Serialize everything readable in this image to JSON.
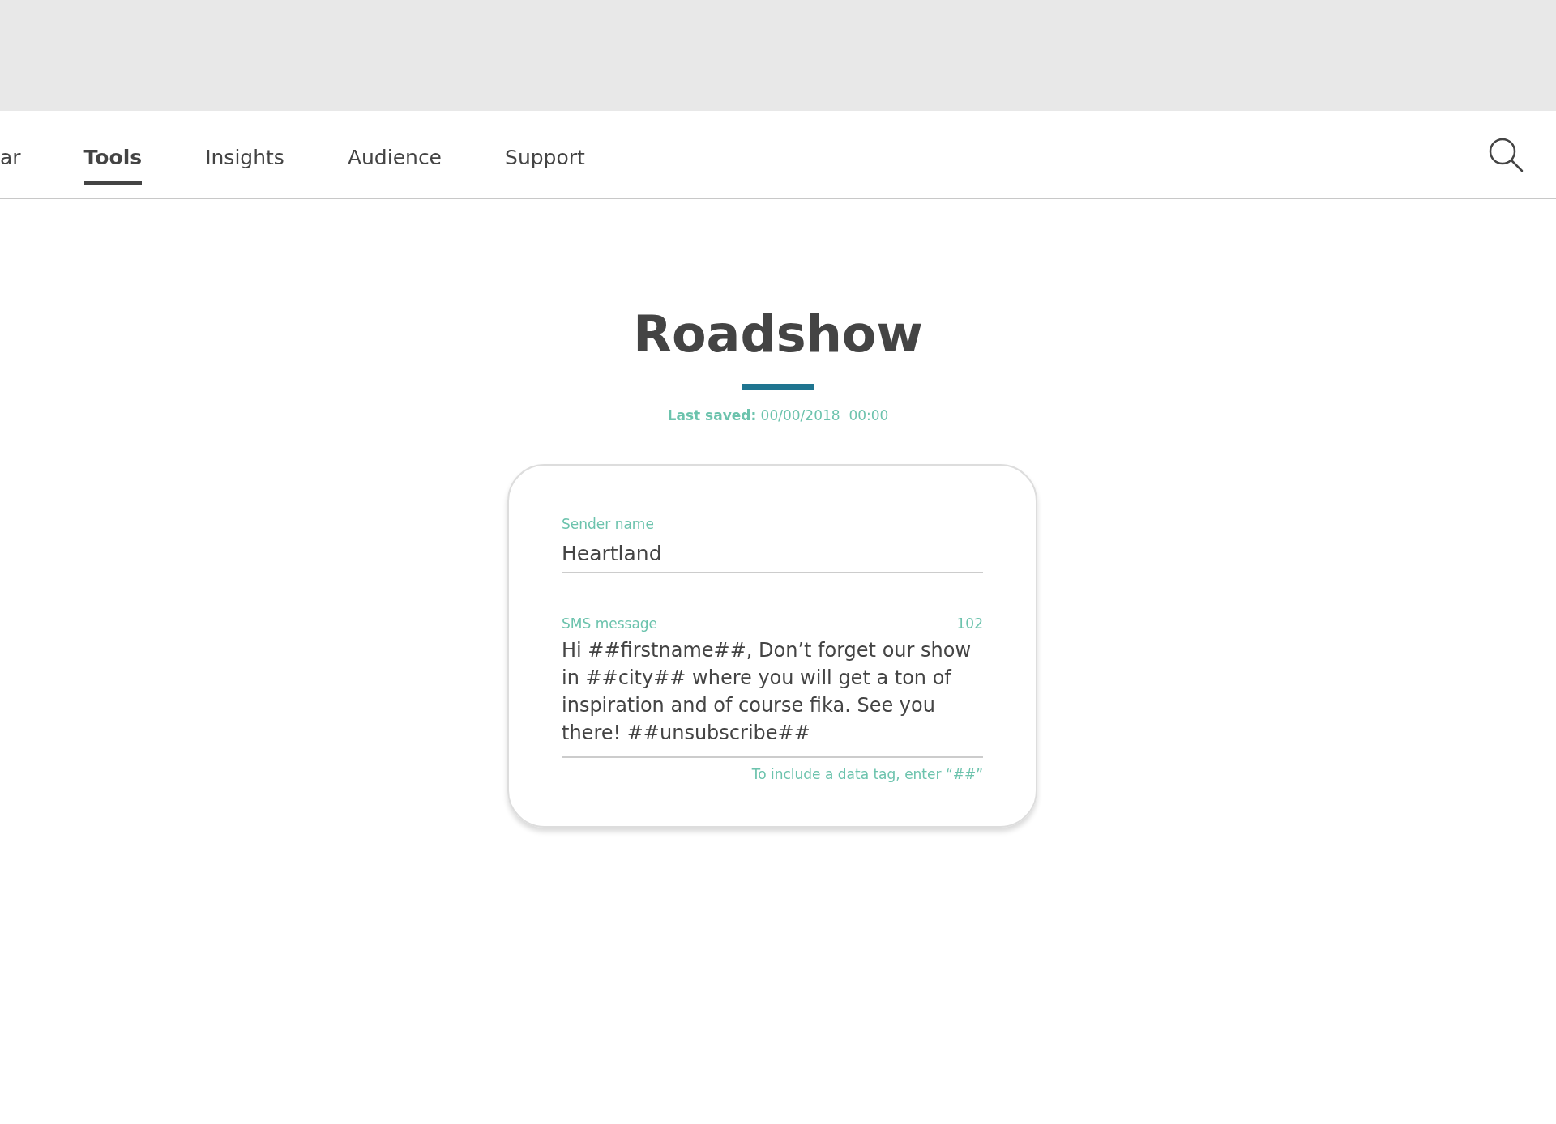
{
  "nav": {
    "tabs": [
      {
        "label": "ar",
        "selected": false
      },
      {
        "label": "Tools",
        "selected": true
      },
      {
        "label": "Insights",
        "selected": false
      },
      {
        "label": "Audience",
        "selected": false
      },
      {
        "label": "Support",
        "selected": false
      }
    ]
  },
  "page": {
    "title": "Roadshow",
    "last_saved": "**Last saved:** 00/00/2018  00:00"
  },
  "form": {
    "sender": {
      "label": "Sender name",
      "value": "Heartland"
    },
    "message": {
      "label": "SMS message",
      "count": "102",
      "value": "Hi ##firstname##, Don’t forget our show in ##city## where you will get a ton of inspiration and of course fika. See you there! ##unsubscribe##",
      "hint": "To include a data tag, enter “##”"
    }
  }
}
